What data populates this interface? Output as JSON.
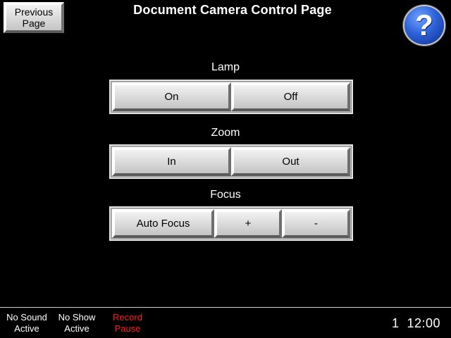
{
  "header": {
    "previous_page": "Previous\nPage",
    "title": "Document Camera Control Page",
    "help_icon": "question-mark-icon",
    "help_glyph": "?"
  },
  "lamp": {
    "label": "Lamp",
    "on": "On",
    "off": "Off"
  },
  "zoom": {
    "label": "Zoom",
    "in": "In",
    "out": "Out"
  },
  "focus": {
    "label": "Focus",
    "auto": "Auto Focus",
    "plus": "+",
    "minus": "-"
  },
  "footer": {
    "sound": "No Sound\nActive",
    "show": "No Show\nActive",
    "record": "Record\nPause",
    "clock": "1  12:00"
  },
  "colors": {
    "background": "#000000",
    "record_status": "#ff1a1a",
    "help_blue": "#2e62d8"
  }
}
